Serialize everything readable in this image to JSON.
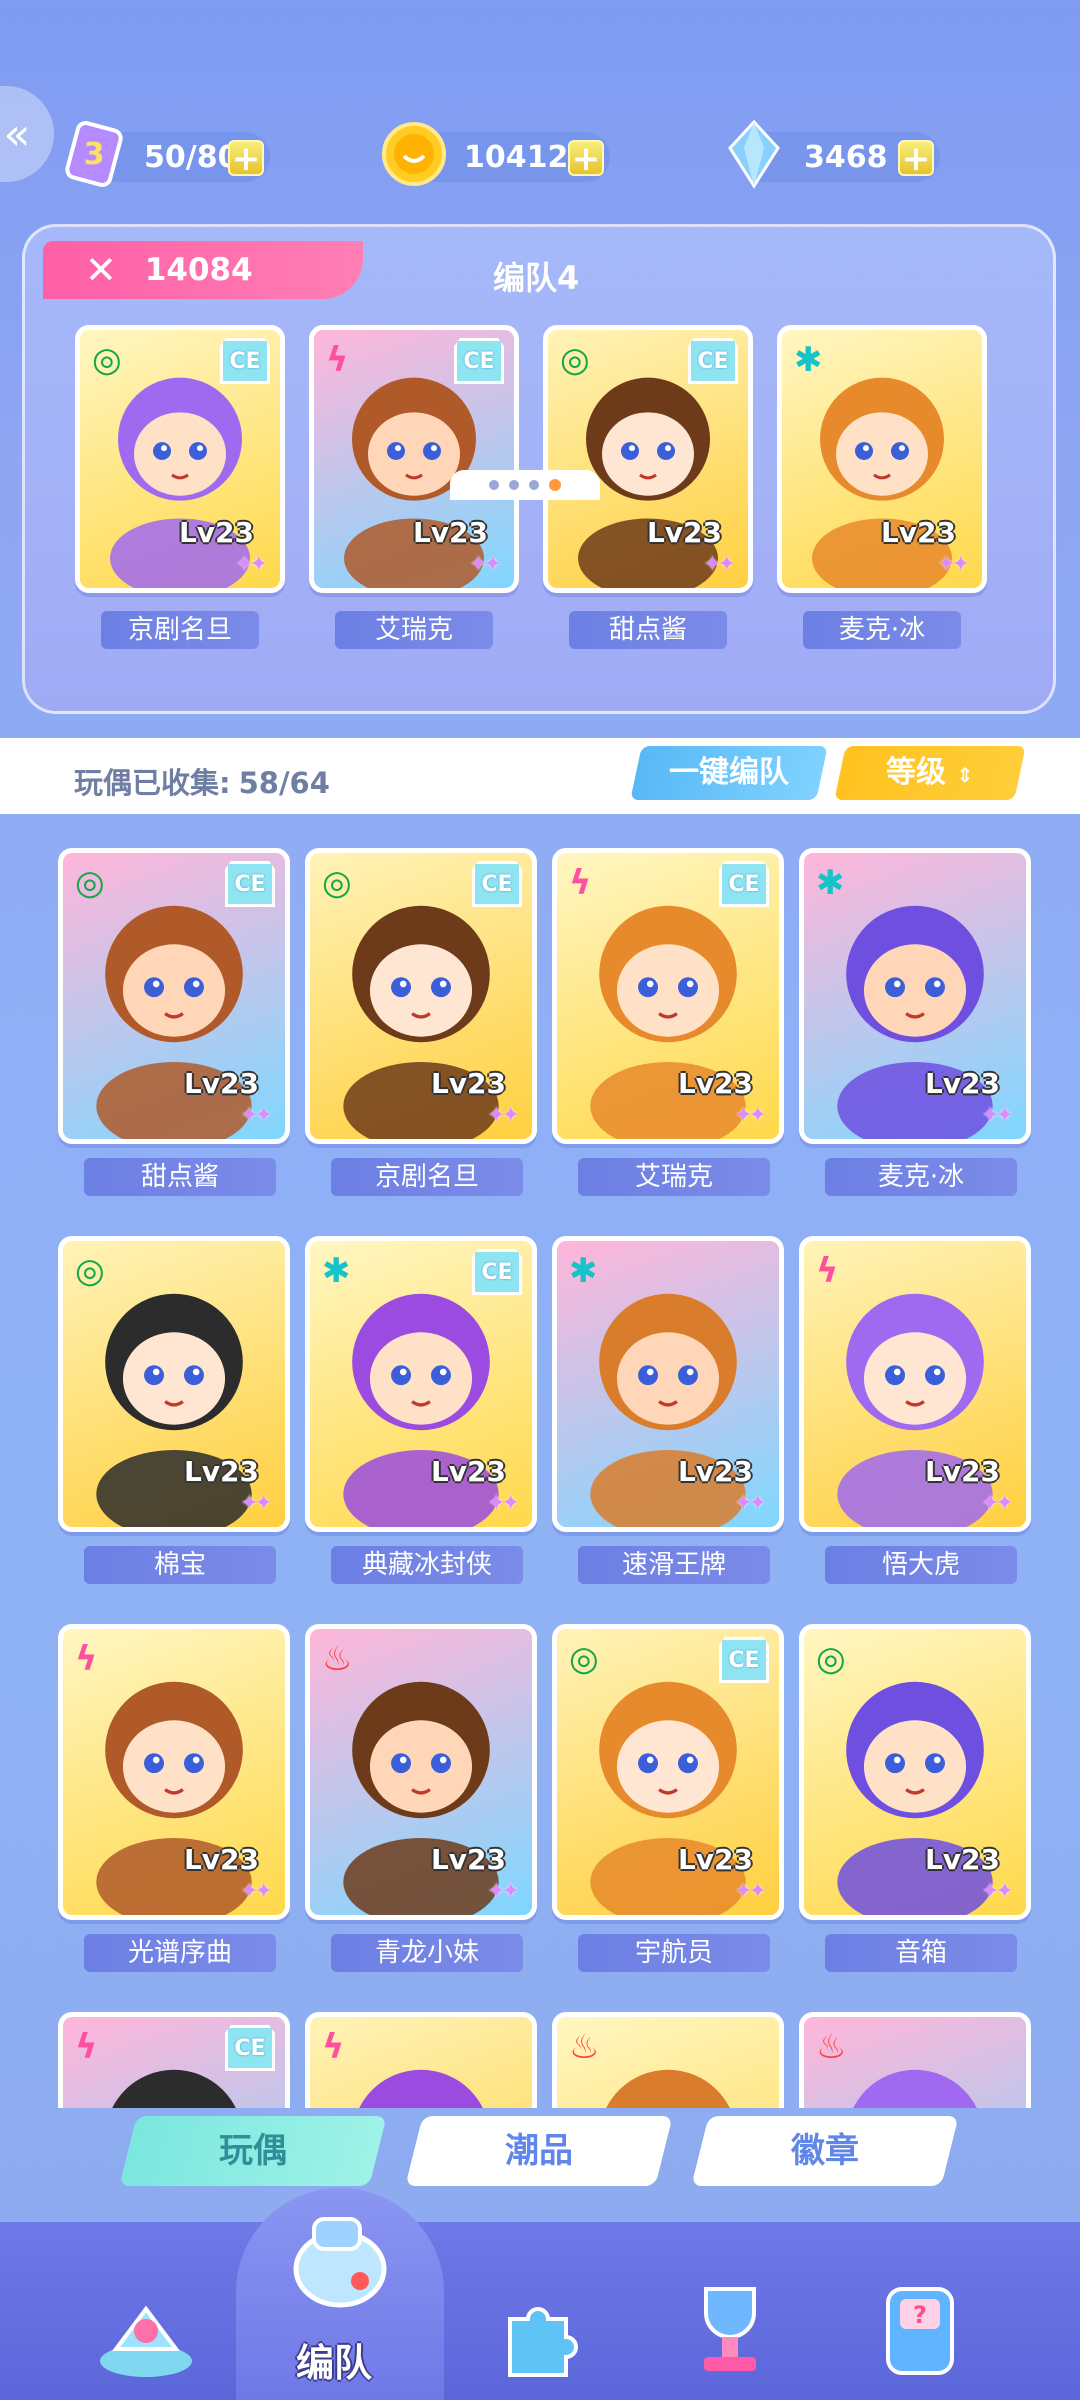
{
  "resources": {
    "stamina": {
      "value": "50/80",
      "icon": "stamina-ticket-icon"
    },
    "coins": {
      "value": "104127",
      "icon": "coin-icon"
    },
    "gems": {
      "value": "3468",
      "icon": "crystal-icon"
    }
  },
  "team": {
    "power": "14084",
    "name": "编队4",
    "members": [
      {
        "name": "京剧名旦",
        "level": "Lv23",
        "element": "swirl",
        "ce": true
      },
      {
        "name": "艾瑞克",
        "level": "Lv23",
        "element": "bolt",
        "ce": true
      },
      {
        "name": "甜点酱",
        "level": "Lv23",
        "element": "swirl",
        "ce": true
      },
      {
        "name": "麦克·冰",
        "level": "Lv23",
        "element": "snow",
        "ce": false
      }
    ],
    "pages": 4,
    "active_page": 4
  },
  "collection": {
    "label": "玩偶已收集:",
    "count": "58/64",
    "auto_button": "一键编队",
    "sort_button": "等级"
  },
  "grid": [
    [
      {
        "name": "甜点酱",
        "level": "Lv23",
        "element": "swirl",
        "ce": true
      },
      {
        "name": "京剧名旦",
        "level": "Lv23",
        "element": "swirl",
        "ce": true
      },
      {
        "name": "艾瑞克",
        "level": "Lv23",
        "element": "bolt",
        "ce": true
      },
      {
        "name": "麦克·冰",
        "level": "Lv23",
        "element": "snow",
        "ce": false
      }
    ],
    [
      {
        "name": "棉宝",
        "level": "Lv23",
        "element": "swirl",
        "ce": false
      },
      {
        "name": "典藏冰封侠",
        "level": "Lv23",
        "element": "snow",
        "ce": true
      },
      {
        "name": "速滑王牌",
        "level": "Lv23",
        "element": "snow",
        "ce": false
      },
      {
        "name": "悟大虎",
        "level": "Lv23",
        "element": "bolt",
        "ce": false
      }
    ],
    [
      {
        "name": "光谱序曲",
        "level": "Lv23",
        "element": "bolt",
        "ce": false
      },
      {
        "name": "青龙小妹",
        "level": "Lv23",
        "element": "fire",
        "ce": false
      },
      {
        "name": "宇航员",
        "level": "Lv23",
        "element": "swirl",
        "ce": true
      },
      {
        "name": "音箱",
        "level": "Lv23",
        "element": "swirl",
        "ce": false
      }
    ],
    [
      {
        "name": "",
        "level": "",
        "element": "bolt",
        "ce": true
      },
      {
        "name": "",
        "level": "",
        "element": "bolt",
        "ce": false
      },
      {
        "name": "",
        "level": "",
        "element": "fire",
        "ce": false
      },
      {
        "name": "",
        "level": "",
        "element": "fire",
        "ce": false
      }
    ]
  ],
  "subtabs": [
    "玩偶",
    "潮品",
    "徽章"
  ],
  "active_subtab": 0,
  "bottom_nav": {
    "active_label": "编队",
    "items": [
      "home-icon",
      "team-whistle-icon",
      "puzzle-icon",
      "trophy-icon",
      "gacha-machine-icon"
    ]
  },
  "colors": {
    "swirl": "#12a84a",
    "bolt": "#ff4fa0",
    "snow": "#16c3c8",
    "fire": "#ff3d3d"
  }
}
